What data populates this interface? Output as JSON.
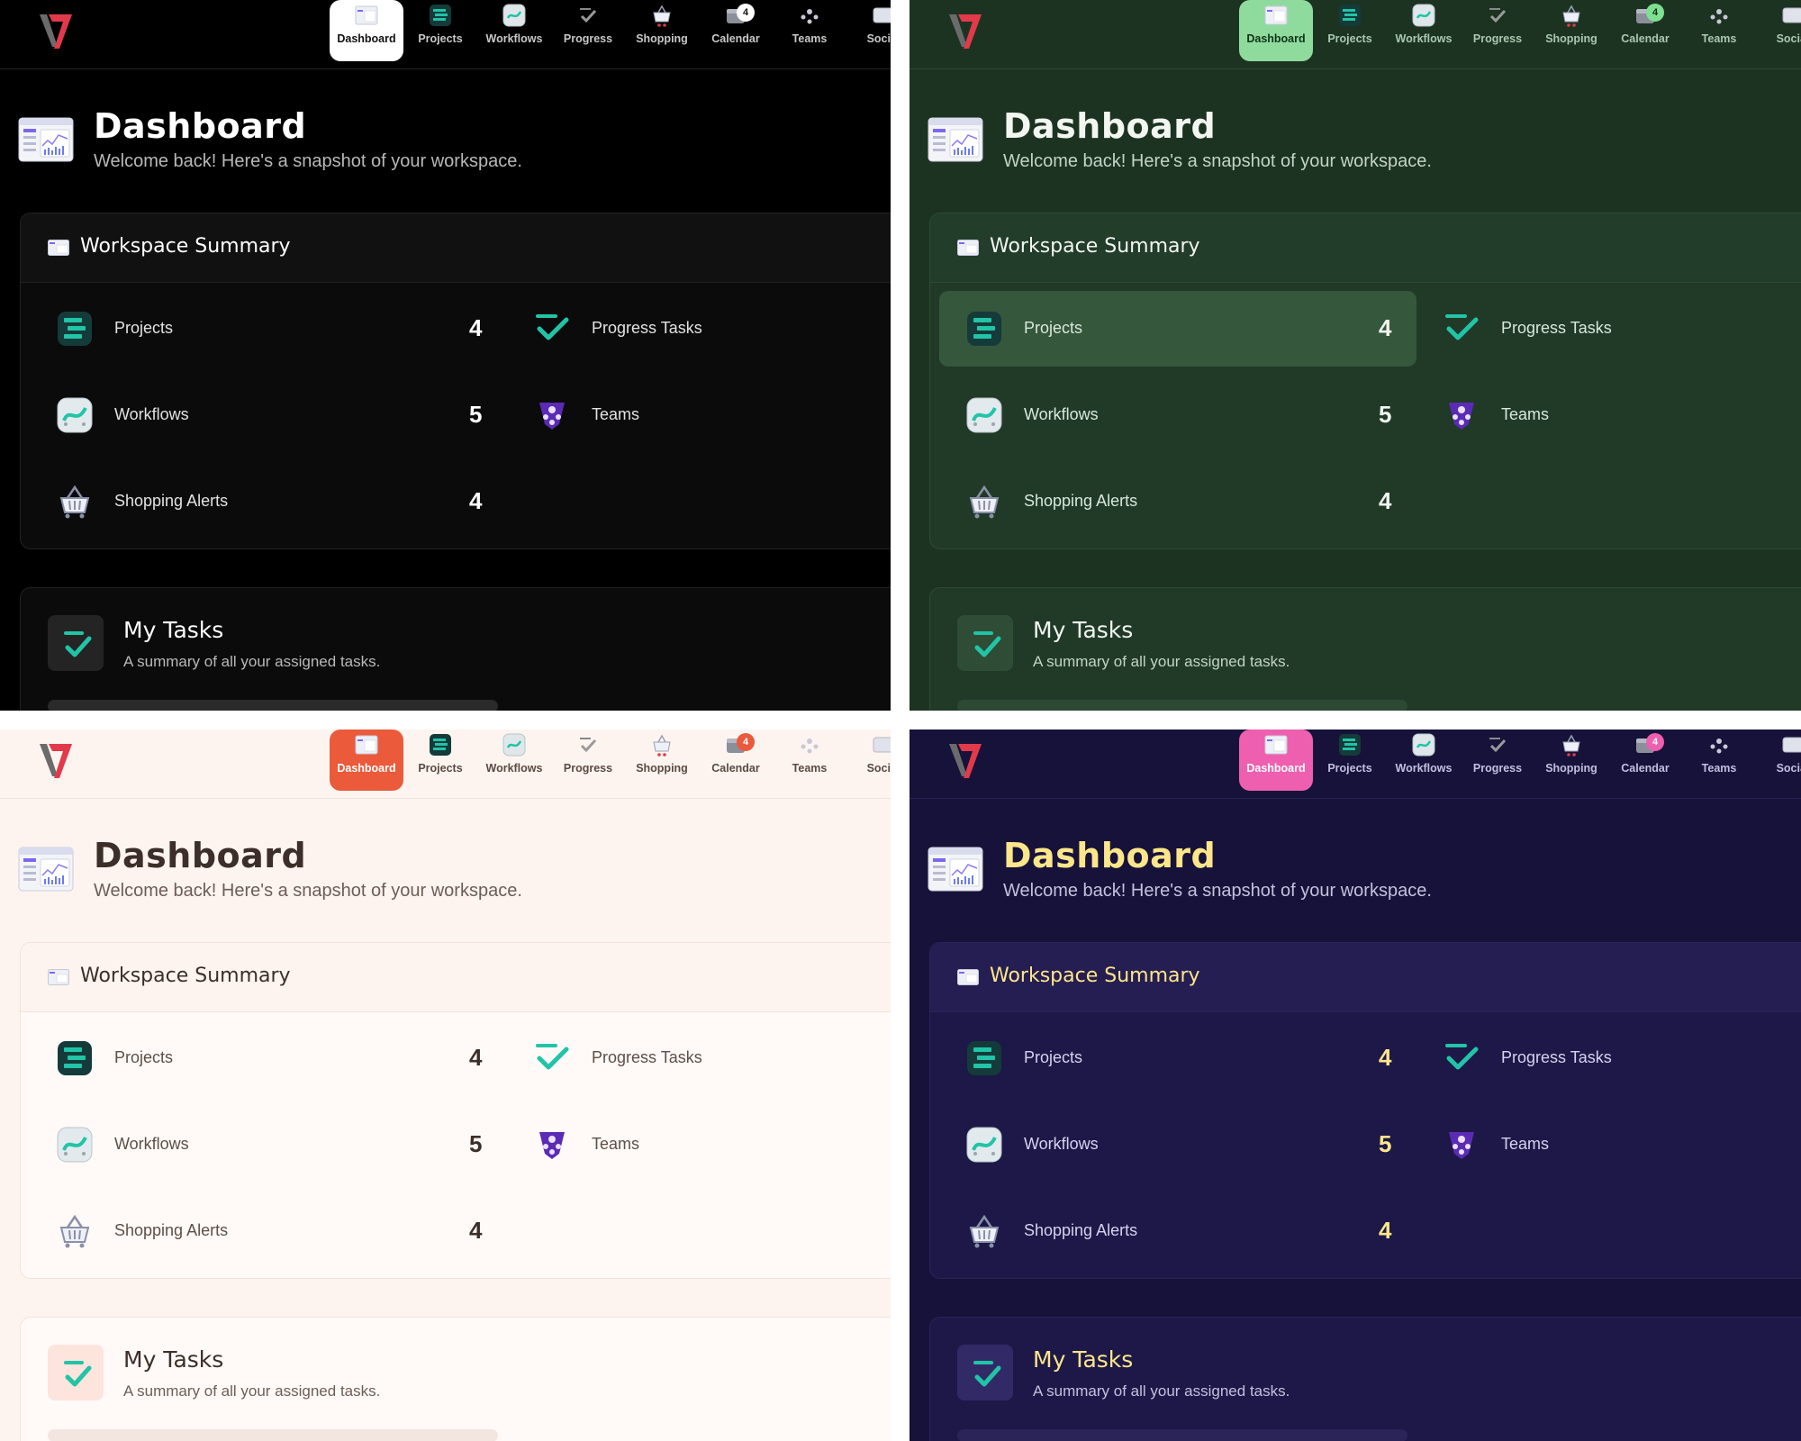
{
  "nav": {
    "tabs": [
      {
        "label": "Dashboard",
        "icon": "dashboard-icon"
      },
      {
        "label": "Projects",
        "icon": "projects-icon"
      },
      {
        "label": "Workflows",
        "icon": "workflows-icon"
      },
      {
        "label": "Progress",
        "icon": "progress-icon"
      },
      {
        "label": "Shopping",
        "icon": "shopping-icon"
      },
      {
        "label": "Calendar",
        "icon": "calendar-icon",
        "badge": "4"
      },
      {
        "label": "Teams",
        "icon": "teams-icon"
      },
      {
        "label": "Social",
        "icon": "social-icon"
      }
    ]
  },
  "header": {
    "title": "Dashboard",
    "subtitle": "Welcome back! Here's a snapshot of your workspace."
  },
  "summary": {
    "title": "Workspace Summary",
    "items": [
      {
        "label": "Projects",
        "value": "4",
        "icon": "projects-icon"
      },
      {
        "label": "Workflows",
        "value": "5",
        "icon": "workflows-icon"
      },
      {
        "label": "Shopping Alerts",
        "value": "4",
        "icon": "shopping-basket-icon"
      },
      {
        "label": "Progress Tasks",
        "value": "",
        "icon": "check-icon"
      },
      {
        "label": "Teams",
        "value": "",
        "icon": "teams-icon"
      }
    ]
  },
  "tasks": {
    "title": "My Tasks",
    "subtitle": "A summary of all your assigned tasks."
  },
  "themes": [
    {
      "name": "black",
      "accent": "#ffffff"
    },
    {
      "name": "green",
      "accent": "#8fdb9d"
    },
    {
      "name": "cream",
      "accent": "#ea5a3b"
    },
    {
      "name": "navy",
      "accent": "#ee5fb0"
    }
  ]
}
